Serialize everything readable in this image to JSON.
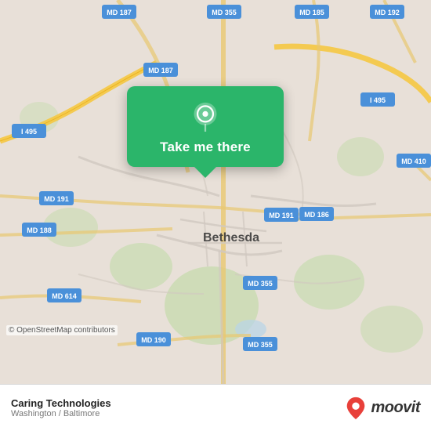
{
  "map": {
    "alt": "Street map of Bethesda, Washington / Baltimore area",
    "center_label": "Bethesda"
  },
  "popup": {
    "label": "Take me there",
    "pin_icon": "location-pin"
  },
  "road_labels": [
    {
      "id": "i495_nw",
      "text": "I 495"
    },
    {
      "id": "i495_ne",
      "text": "I 495"
    },
    {
      "id": "md187_n",
      "text": "MD 187"
    },
    {
      "id": "md187_c",
      "text": "MD 187"
    },
    {
      "id": "md355_n",
      "text": "MD 355"
    },
    {
      "id": "md355_s1",
      "text": "MD 355"
    },
    {
      "id": "md355_s2",
      "text": "MD 355"
    },
    {
      "id": "md185",
      "text": "MD 185"
    },
    {
      "id": "md192",
      "text": "MD 192"
    },
    {
      "id": "md191_w",
      "text": "MD 191"
    },
    {
      "id": "md191_e",
      "text": "MD 191"
    },
    {
      "id": "md188",
      "text": "MD 188"
    },
    {
      "id": "md186",
      "text": "MD 186"
    },
    {
      "id": "md410",
      "text": "MD 410"
    },
    {
      "id": "md614",
      "text": "MD 614"
    },
    {
      "id": "md190",
      "text": "MD 190"
    }
  ],
  "bottom_bar": {
    "title": "Caring Technologies",
    "subtitle": "Washington / Baltimore",
    "osm_credit": "© OpenStreetMap contributors",
    "logo_text": "moovit"
  }
}
